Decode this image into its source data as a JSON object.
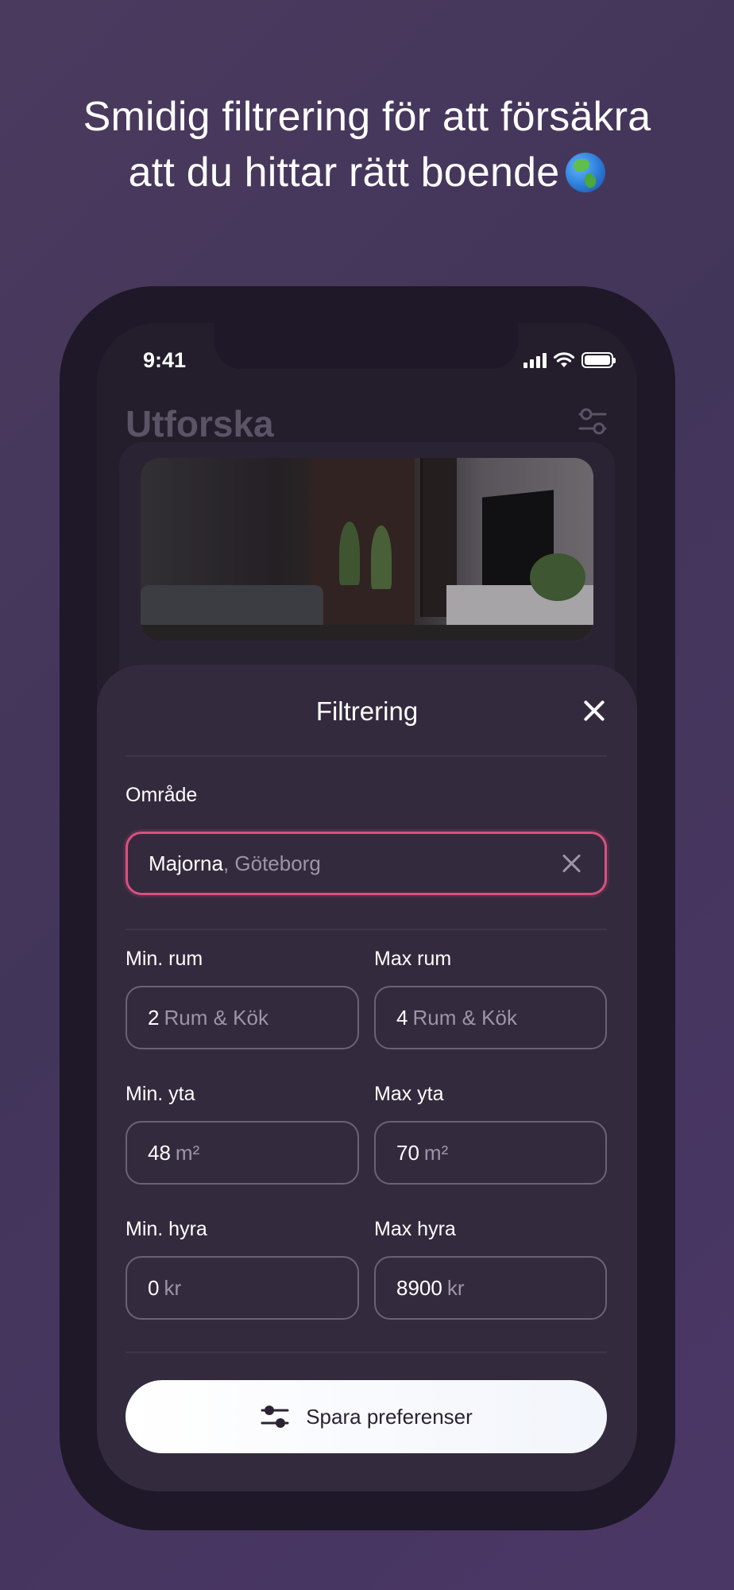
{
  "headline": {
    "line1": "Smidig filtrering för att försäkra",
    "line2": "att du hittar rätt boende"
  },
  "icons": {
    "globe": "globe-emoji-icon",
    "filter": "sliders-icon",
    "close": "close-icon",
    "clear": "clear-icon"
  },
  "status_bar": {
    "time": "9:41"
  },
  "background_screen": {
    "title": "Utforska"
  },
  "filter_sheet": {
    "title": "Filtrering",
    "area": {
      "label": "Område",
      "value": "Majorna",
      "suffix": ", Göteborg"
    },
    "min_rooms": {
      "label": "Min. rum",
      "value": "2",
      "unit": "Rum & Kök"
    },
    "max_rooms": {
      "label": "Max rum",
      "value": "4",
      "unit": "Rum & Kök"
    },
    "min_area": {
      "label": "Min. yta",
      "value": "48",
      "unit": "m²"
    },
    "max_area": {
      "label": "Max yta",
      "value": "70",
      "unit": "m²"
    },
    "min_rent": {
      "label": "Min. hyra",
      "value": "0",
      "unit": "kr"
    },
    "max_rent": {
      "label": "Max hyra",
      "value": "8900",
      "unit": "kr"
    },
    "save_button": "Spara preferenser"
  },
  "colors": {
    "background": "#463860",
    "sheet": "#342a3d",
    "accent_border": "#d9507f",
    "button_bg": "#ffffff"
  }
}
